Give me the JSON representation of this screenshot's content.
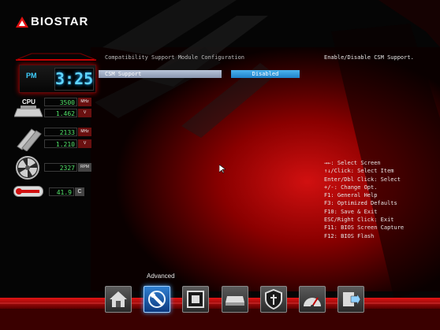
{
  "brand": {
    "name": "BIOSTAR"
  },
  "clock": {
    "meridiem": "PM",
    "time": "3:25"
  },
  "monitor": {
    "cpu_label": "CPU",
    "cpu_freq": "3500",
    "cpu_freq_unit": "MHz",
    "cpu_voltage": "1.462",
    "cpu_voltage_unit": "V",
    "mem_freq": "2133",
    "mem_freq_unit": "MHz",
    "mem_voltage": "1.210",
    "mem_voltage_unit": "V",
    "fan_speed": "2327",
    "fan_speed_unit": "RPM",
    "temperature": "41.9",
    "temperature_unit": "C"
  },
  "page": {
    "section_title": "Compatibility Support Module Configuration",
    "help": "Enable/Disable CSM Support."
  },
  "settings": [
    {
      "label": "CSM Support",
      "value": "Disabled"
    }
  ],
  "key_help": [
    "→←: Select Screen",
    "↑↓/Click: Select Item",
    "Enter/Dbl Click: Select",
    "+/-: Change Opt.",
    "F1: General Help",
    "F3: Optimized Defaults",
    "F10: Save & Exit",
    "ESC/Right Click: Exit",
    "F11: BIOS Screen Capture",
    "F12: BIOS Flash"
  ],
  "dock": {
    "active_title": "Advanced",
    "items": [
      {
        "icon": "home-icon",
        "label": "Main",
        "active": false
      },
      {
        "icon": "advanced-icon",
        "label": "Advanced",
        "active": true
      },
      {
        "icon": "chipset-icon",
        "label": "Chipset",
        "active": false
      },
      {
        "icon": "boot-icon",
        "label": "Boot",
        "active": false
      },
      {
        "icon": "security-icon",
        "label": "Security",
        "active": false
      },
      {
        "icon": "o-n-e-icon",
        "label": "O.N.E",
        "active": false
      },
      {
        "icon": "save-exit-icon",
        "label": "Save & Exit",
        "active": false
      }
    ]
  },
  "colors": {
    "accent_red": "#c80000",
    "highlight_blue": "#2a96dc",
    "lcd_green": "#52e36a",
    "clock_blue": "#5fd4ff"
  }
}
